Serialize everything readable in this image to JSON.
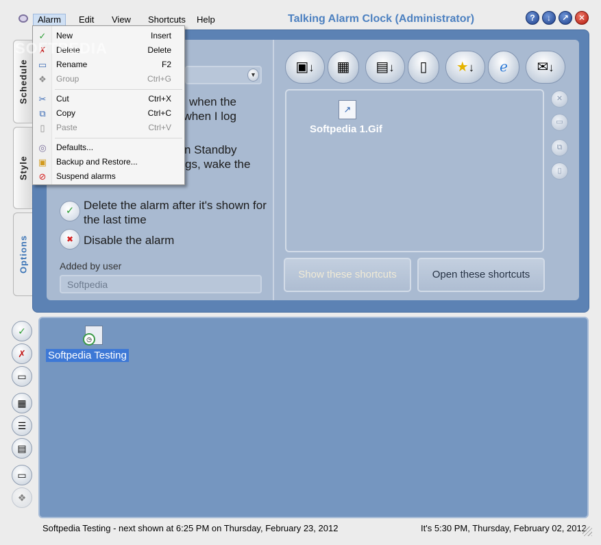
{
  "window": {
    "title": "Talking Alarm Clock (Administrator)"
  },
  "menubar": [
    "Alarm",
    "Edit",
    "View",
    "Shortcuts",
    "Help"
  ],
  "title_buttons": {
    "help": "?",
    "down": "↓",
    "up": "↗",
    "close": "✕"
  },
  "tabs": [
    "Schedule",
    "Style",
    "Options"
  ],
  "alarm_menu": [
    {
      "label": "New",
      "shortcut": "Insert",
      "icon": "check-icon"
    },
    {
      "label": "Delete",
      "shortcut": "Delete",
      "icon": "red-x-icon"
    },
    {
      "label": "Rename",
      "shortcut": "F2",
      "icon": "rename-icon"
    },
    {
      "label": "Group",
      "shortcut": "Ctrl+G",
      "icon": "group-icon"
    },
    {
      "label": "Cut",
      "shortcut": "Ctrl+X",
      "icon": "scissors-icon"
    },
    {
      "label": "Copy",
      "shortcut": "Ctrl+C",
      "icon": "copy-icon"
    },
    {
      "label": "Paste",
      "shortcut": "Ctrl+V",
      "icon": "paste-icon"
    },
    {
      "label": "Defaults...",
      "shortcut": "",
      "icon": "defaults-icon"
    },
    {
      "label": "Backup and Restore...",
      "shortcut": "",
      "icon": "backup-icon"
    },
    {
      "label": "Suspend alarms",
      "shortcut": "",
      "icon": "no-entry-icon"
    }
  ],
  "options": {
    "partial_lines": [
      "when the",
      "t when I log",
      "n Standby",
      "gs, wake the"
    ],
    "delete_after_shown": "Delete the alarm after it's shown for the last time",
    "disable_alarm": "Disable the alarm",
    "added_by_label": "Added by user",
    "added_by_value": "Softpedia"
  },
  "shortcuts": {
    "file_name": "Softpedia 1.Gif",
    "show_button": "Show these shortcuts",
    "open_button": "Open these shortcuts"
  },
  "alarm_list": {
    "item_label": "Softpedia Testing"
  },
  "status": {
    "left": "Softpedia Testing - next shown at 6:25 PM on Thursday, February 23, 2012",
    "right": "It's 5:30 PM, Thursday, February 02, 2012"
  },
  "watermark": "SOFTPEDIA",
  "colors": {
    "accent": "#4c80c0",
    "panel": "#5c82b4",
    "content": "#a9bad1",
    "selection": "#3d78d6"
  }
}
